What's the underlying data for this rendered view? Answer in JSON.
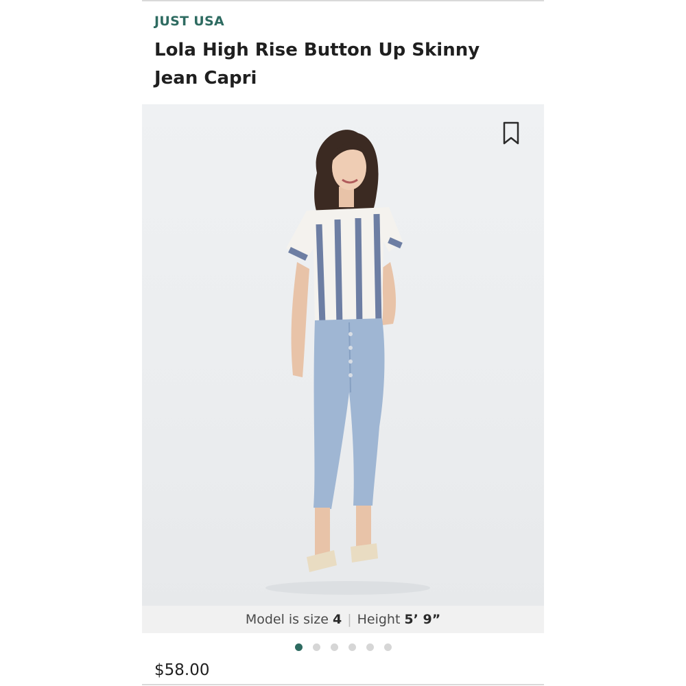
{
  "product": {
    "brand": "JUST USA",
    "title": "Lola High Rise Button Up Skinny Jean Capri",
    "price": "$58.00"
  },
  "model_info": {
    "size_prefix": "Model is size",
    "size_value": "4",
    "separator": "|",
    "height_prefix": "Height",
    "height_value": "5’ 9”"
  },
  "gallery": {
    "image_count": 6,
    "active_index": 0,
    "bookmark_icon": "bookmark-icon"
  },
  "colors": {
    "brand_accent": "#2e6b61",
    "inactive_dot": "#d6d6d6"
  }
}
